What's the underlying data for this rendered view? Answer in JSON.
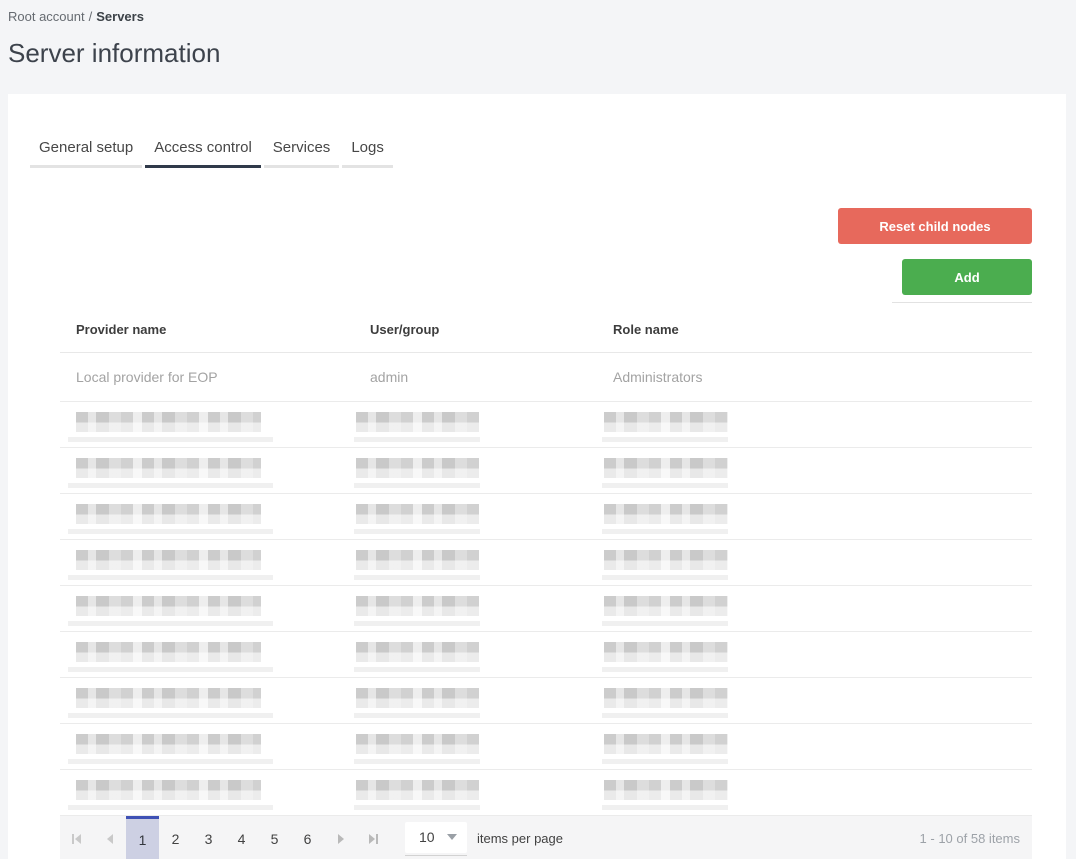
{
  "breadcrumb": {
    "root": "Root account",
    "separator": "/",
    "current": "Servers"
  },
  "page_title": "Server information",
  "tabs": [
    {
      "label": "General setup",
      "active": false
    },
    {
      "label": "Access control",
      "active": true
    },
    {
      "label": "Services",
      "active": false
    },
    {
      "label": "Logs",
      "active": false
    }
  ],
  "toolbar": {
    "reset_button": "Reset child nodes",
    "add_button": "Add"
  },
  "table": {
    "columns": [
      "Provider name",
      "User/group",
      "Role name"
    ],
    "rows": [
      {
        "provider": "Local provider for EOP",
        "user_group": "admin",
        "role": "Administrators",
        "redacted": false
      }
    ],
    "redacted_row_count": 9
  },
  "pager": {
    "pages": [
      "1",
      "2",
      "3",
      "4",
      "5",
      "6"
    ],
    "current_page": "1",
    "page_size": "10",
    "items_per_page_label": "items per page",
    "range_label": "1 - 10 of 58 items",
    "icons": [
      "first-page-icon",
      "previous-page-icon",
      "next-page-icon",
      "last-page-icon",
      "dropdown-caret-icon"
    ]
  },
  "colors": {
    "reset": "#e7695c",
    "add": "#4bad4f",
    "accent": "#3f51b5",
    "selected_bg": "#cdd0e3",
    "page_bg": "#f4f5f7"
  }
}
